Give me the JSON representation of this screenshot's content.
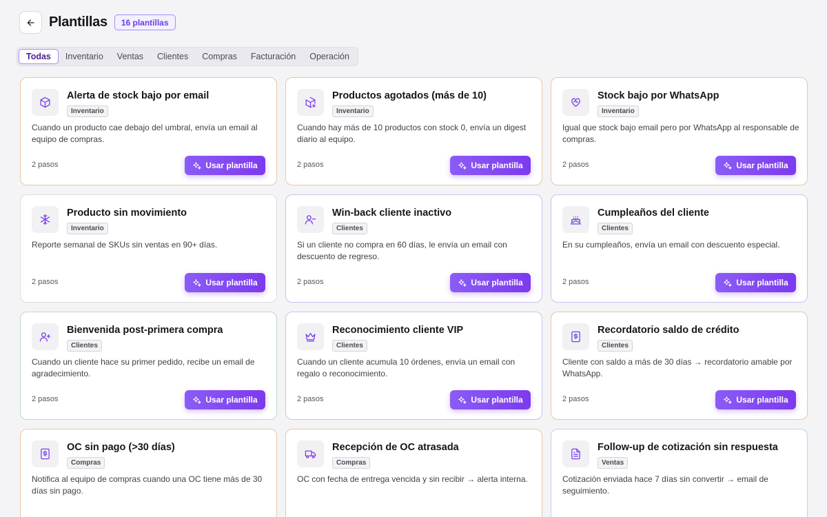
{
  "header": {
    "title": "Plantillas",
    "count_badge": "16 plantillas"
  },
  "tabs": [
    "Todas",
    "Inventario",
    "Ventas",
    "Clientes",
    "Compras",
    "Facturación",
    "Operación"
  ],
  "active_tab": "Todas",
  "button_label": "Usar plantilla",
  "cards": [
    {
      "title": "Alerta de stock bajo por email",
      "category": "Inventario",
      "desc": "Cuando un producto cae debajo del umbral, envía un email al equipo de compras.",
      "steps": "2 pasos",
      "icon": "box-icon"
    },
    {
      "title": "Productos agotados (más de 10)",
      "category": "Inventario",
      "desc": "Cuando hay más de 10 productos con stock 0, envía un digest diario al equipo.",
      "steps": "2 pasos",
      "icon": "box-x-icon"
    },
    {
      "title": "Stock bajo por WhatsApp",
      "category": "Inventario",
      "desc": "Igual que stock bajo email pero por WhatsApp al responsable de compras.",
      "steps": "2 pasos",
      "icon": "heart-handshake-icon"
    },
    {
      "title": "Producto sin movimiento",
      "category": "Inventario",
      "desc": "Reporte semanal de SKUs sin ventas en 90+ días.",
      "steps": "2 pasos",
      "icon": "snowflake-icon"
    },
    {
      "title": "Win-back cliente inactivo",
      "category": "Clientes",
      "desc": "Si un cliente no compra en 60 días, le envía un email con descuento de regreso.",
      "steps": "2 pasos",
      "icon": "user-minus-icon"
    },
    {
      "title": "Cumpleaños del cliente",
      "category": "Clientes",
      "desc": "En su cumpleaños, envía un email con descuento especial.",
      "steps": "2 pasos",
      "icon": "cake-icon"
    },
    {
      "title": "Bienvenida post-primera compra",
      "category": "Clientes",
      "desc": "Cuando un cliente hace su primer pedido, recibe un email de agradecimiento.",
      "steps": "2 pasos",
      "icon": "user-plus-icon"
    },
    {
      "title": "Reconocimiento cliente VIP",
      "category": "Clientes",
      "desc": "Cuando un cliente acumula 10 órdenes, envía un email con regalo o reconocimiento.",
      "steps": "2 pasos",
      "icon": "crown-icon"
    },
    {
      "title": "Recordatorio saldo de crédito",
      "category": "Clientes",
      "desc": "Cliente con saldo a más de 30 días → recordatorio amable por WhatsApp.",
      "steps": "2 pasos",
      "icon": "receipt-dollar-icon"
    },
    {
      "title": "OC sin pago (>30 días)",
      "category": "Compras",
      "desc": "Notifica al equipo de compras cuando una OC tiene más de 30 días sin pago.",
      "steps": "",
      "icon": "receipt-dollar-icon"
    },
    {
      "title": "Recepción de OC atrasada",
      "category": "Compras",
      "desc": "OC con fecha de entrega vencida y sin recibir → alerta interna.",
      "steps": "",
      "icon": "truck-icon"
    },
    {
      "title": "Follow-up de cotización sin respuesta",
      "category": "Ventas",
      "desc": "Cotización enviada hace 7 días sin convertir → email de seguimiento.",
      "steps": "",
      "icon": "file-text-icon"
    }
  ],
  "colors": {
    "accent": "#7c3aed",
    "icon": "#7c3aed"
  }
}
